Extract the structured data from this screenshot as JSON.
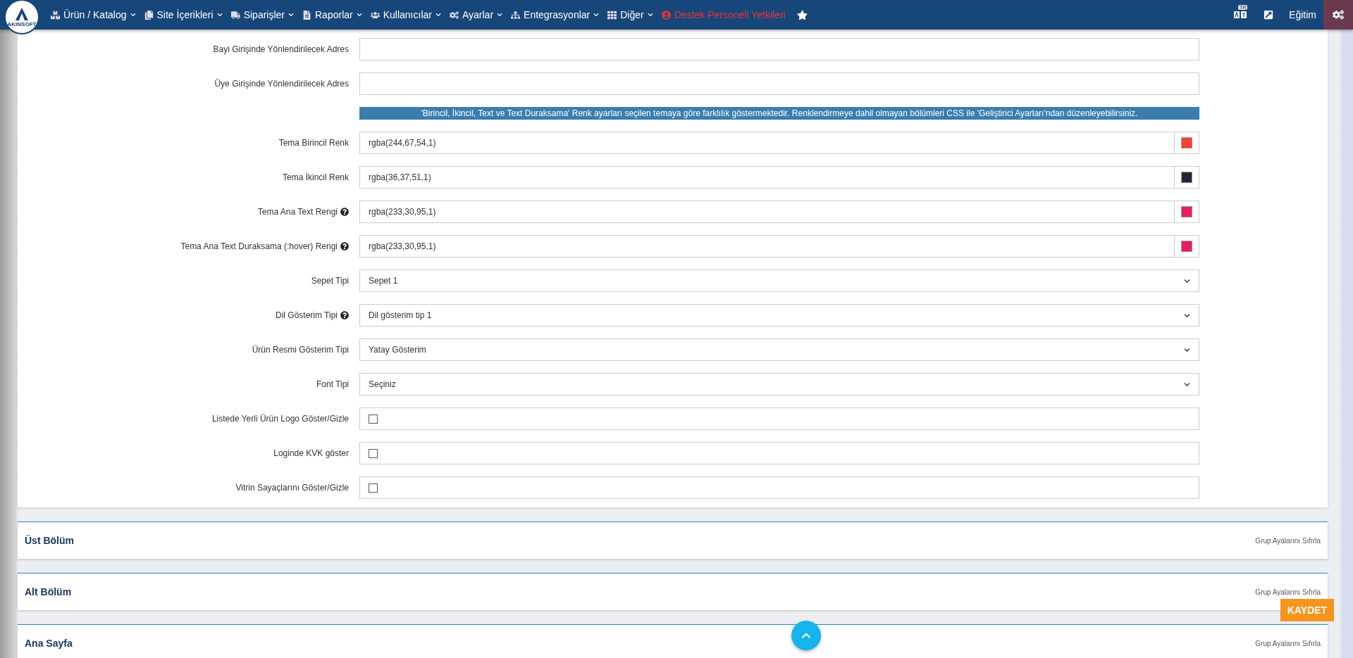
{
  "nav": {
    "logo_text": "AKINSOFT",
    "menus": [
      {
        "label": "Ürün / Katalog"
      },
      {
        "label": "Site İçerikleri"
      },
      {
        "label": "Siparişler"
      },
      {
        "label": "Raporlar"
      },
      {
        "label": "Kullanıcılar"
      },
      {
        "label": "Ayarlar"
      },
      {
        "label": "Entegrasyonlar"
      },
      {
        "label": "Diğer"
      }
    ],
    "support_link": "Destek Personeli Yetkileri",
    "language_badge": "TR",
    "user": "Eğitim"
  },
  "form_rows": [
    {
      "kind": "text",
      "label": "Bayi Girişinde Yönlendirilecek Adres"
    },
    {
      "kind": "text",
      "label": "Üye Girişinde Yönlendirilecek Adres"
    },
    {
      "kind": "notice",
      "text": "'Birincil, İkincil, Text ve Text Duraksama' Renk ayarları seçilen temaya göre farklılık göstermektedir. Renklendirmeye dahil olmayan bölümleri CSS ile 'Geliştirici Ayarları'ndan düzenleyebilirsiniz."
    },
    {
      "kind": "color",
      "label": "Tema Birincil Renk",
      "value": "rgba(244,67,54,1)",
      "color": "#f44336"
    },
    {
      "kind": "color",
      "label": "Tema İkincil Renk",
      "value": "rgba(36,37,51,1)",
      "color": "#242533"
    },
    {
      "kind": "color",
      "label": "Tema Ana Text Rengi",
      "value": "rgba(233,30,95,1)",
      "color": "#e91e5f",
      "help": true
    },
    {
      "kind": "color",
      "label": "Tema Ana Text Duraksama (:hover) Rengi",
      "value": "rgba(233,30,95,1)",
      "color": "#e91e5f",
      "help": true
    },
    {
      "kind": "select",
      "label": "Sepet Tipi",
      "value": "Sepet 1"
    },
    {
      "kind": "select",
      "label": "Dil Gösterim Tipi",
      "value": "Dil gösterim tip 1",
      "help": true
    },
    {
      "kind": "select",
      "label": "Ürün Resmi Gösterim Tipi",
      "value": "Yatay Gösterim"
    },
    {
      "kind": "select",
      "label": "Font Tipi",
      "value": "Seçiniz"
    },
    {
      "kind": "checkbox",
      "label": "Listede Yerli Ürün Logo Göster/Gizle",
      "checked": false
    },
    {
      "kind": "checkbox",
      "label": "Loginde KVK göster",
      "checked": false
    },
    {
      "kind": "checkbox",
      "label": "Vitrin Sayaçlarını Göster/Gizle",
      "checked": false
    }
  ],
  "sections": [
    {
      "title": "Üst Bölüm",
      "action": "Grup Ayalarını Sıfırla"
    },
    {
      "title": "Alt Bölüm",
      "action": "Grup Ayalarını Sıfırla"
    },
    {
      "title": "Ana Sayfa",
      "action": "Grup Ayalarını Sıfırla"
    }
  ],
  "save_button": "KAYDET"
}
